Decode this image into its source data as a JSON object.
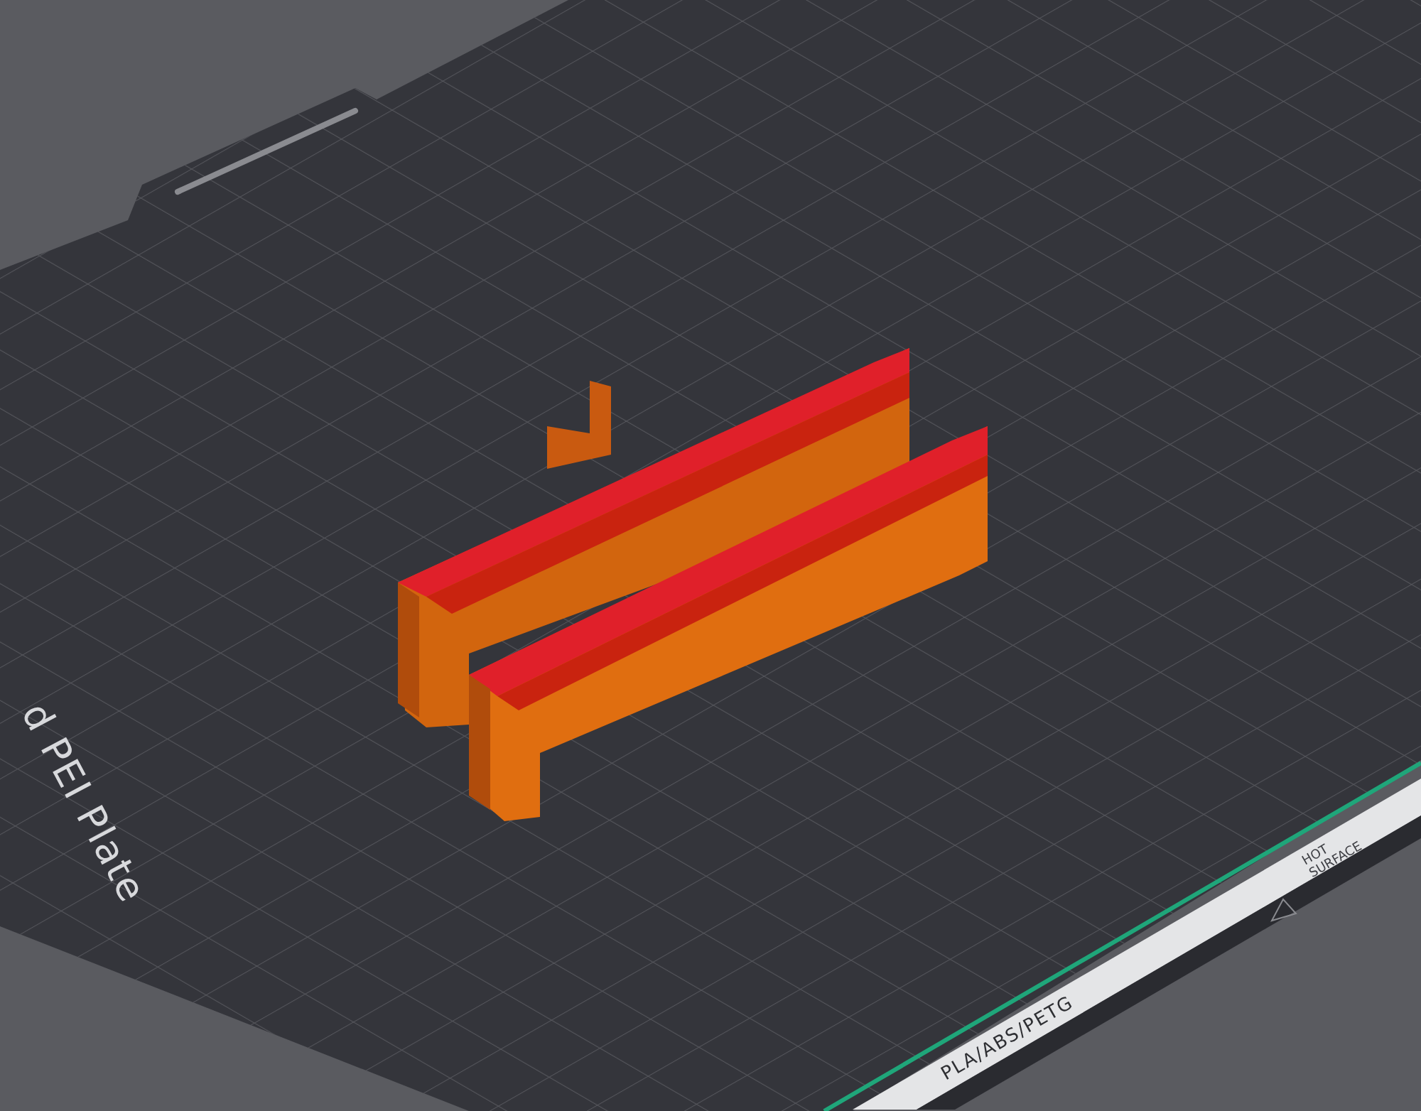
{
  "plate": {
    "name_label": "d PEI Plate",
    "filament_label": "PLA/ABS/PETG",
    "warning_lines": [
      "HOT",
      "SURFACE"
    ]
  }
}
